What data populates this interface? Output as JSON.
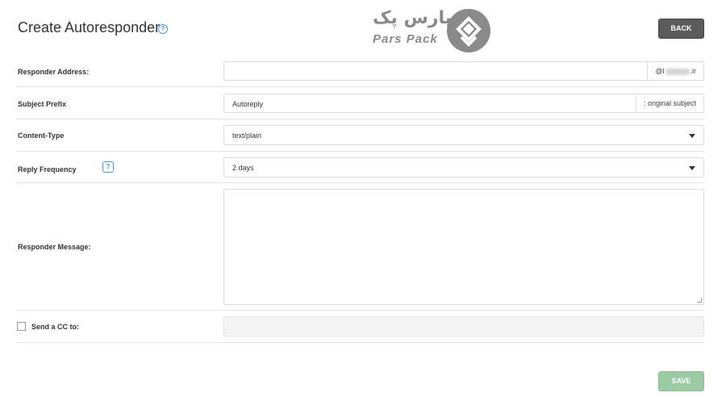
{
  "header": {
    "title": "Create Autoresponder",
    "help_glyph": "?",
    "back_label": "BACK"
  },
  "logo": {
    "fa_text": "پارس پک",
    "en_text": "Pars Pack"
  },
  "form": {
    "responder_address": {
      "label": "Responder Address:",
      "value": "",
      "domain_prefix": "@l",
      "domain_suffix": ".ir"
    },
    "subject_prefix": {
      "label": "Subject Prefix",
      "value": "Autoreply",
      "suffix": ": original subject"
    },
    "content_type": {
      "label": "Content-Type",
      "selected": "text/plain"
    },
    "reply_frequency": {
      "label": "Reply Frequency",
      "help_glyph": "?",
      "selected": "2 days"
    },
    "responder_message": {
      "label": "Responder Message:",
      "value": ""
    },
    "send_cc": {
      "label": "Send a CC to:",
      "checked": false,
      "value": ""
    }
  },
  "footer": {
    "save_label": "SAVE"
  },
  "colors": {
    "back_button": "#5b5b5b",
    "save_button": "#9ccaa2",
    "help_accent": "#4a9ad4",
    "logo_gray": "#8a8a8a"
  }
}
